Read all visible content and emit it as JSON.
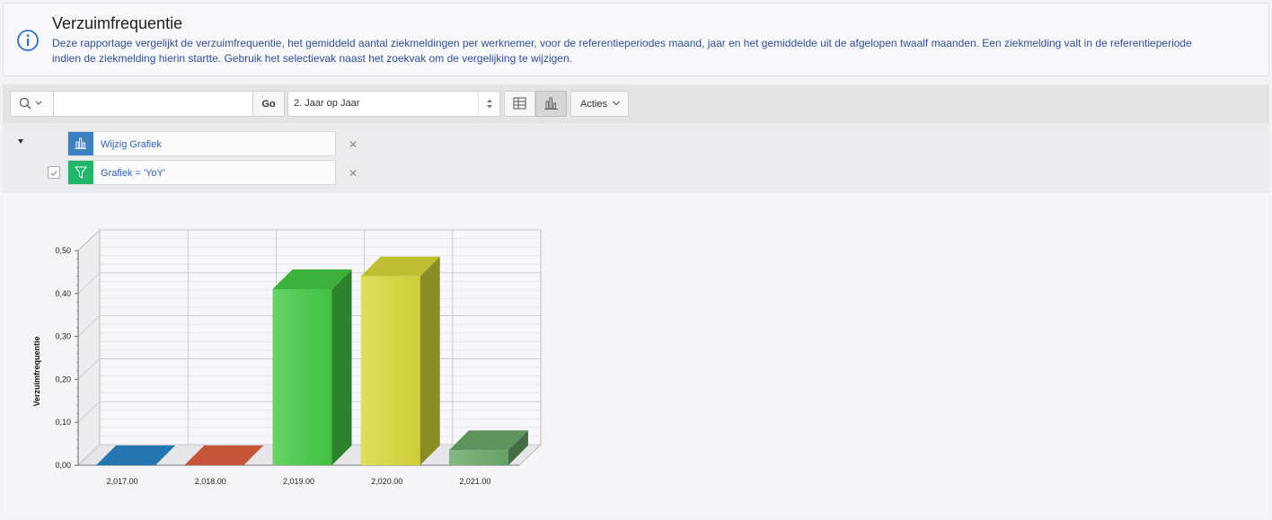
{
  "info": {
    "title": "Verzuimfrequentie",
    "text": "Deze rapportage vergelijkt de verzuimfrequentie, het gemiddeld aantal ziekmeldingen per werknemer, voor de referentieperiodes maand, jaar en het gemiddelde uit de afgelopen twaalf maanden. Een ziekmelding valt in de referentieperiode indien de ziekmelding hierin startte. Gebruik het selectievak naast het zoekvak om de vergelijking te wijzigen.",
    "icon": "info-icon"
  },
  "toolbar": {
    "search_value": "",
    "go_label": "Go",
    "select_value": "2. Jaar op Jaar",
    "acties_label": "Acties"
  },
  "filters": [
    {
      "label": "Wijzig Grafiek",
      "color": "#3d7fc1",
      "icon": "bar-chart-icon"
    },
    {
      "label": "Grafiek = 'YoY'",
      "color": "#21b66a",
      "icon": "filter-icon"
    }
  ],
  "colors": {
    "info_text": "#2f4f9a",
    "link": "#2a62b8"
  },
  "chart_data": {
    "type": "bar",
    "categories": [
      "2,017.00",
      "2,018.00",
      "2,019.00",
      "2,020.00",
      "2,021.00"
    ],
    "values": [
      0.0,
      0.0,
      0.41,
      0.44,
      0.035
    ],
    "colors": [
      "#2a86c8",
      "#e06040",
      "#44c944",
      "#d8d83a",
      "#6aa86a"
    ],
    "ylabel": "Verzuimfrequentie",
    "ylim": [
      0,
      0.5
    ],
    "yticks": [
      "0,00",
      "0,10",
      "0,20",
      "0,30",
      "0,40",
      "0,50"
    ],
    "grid": true,
    "style": "3d"
  }
}
